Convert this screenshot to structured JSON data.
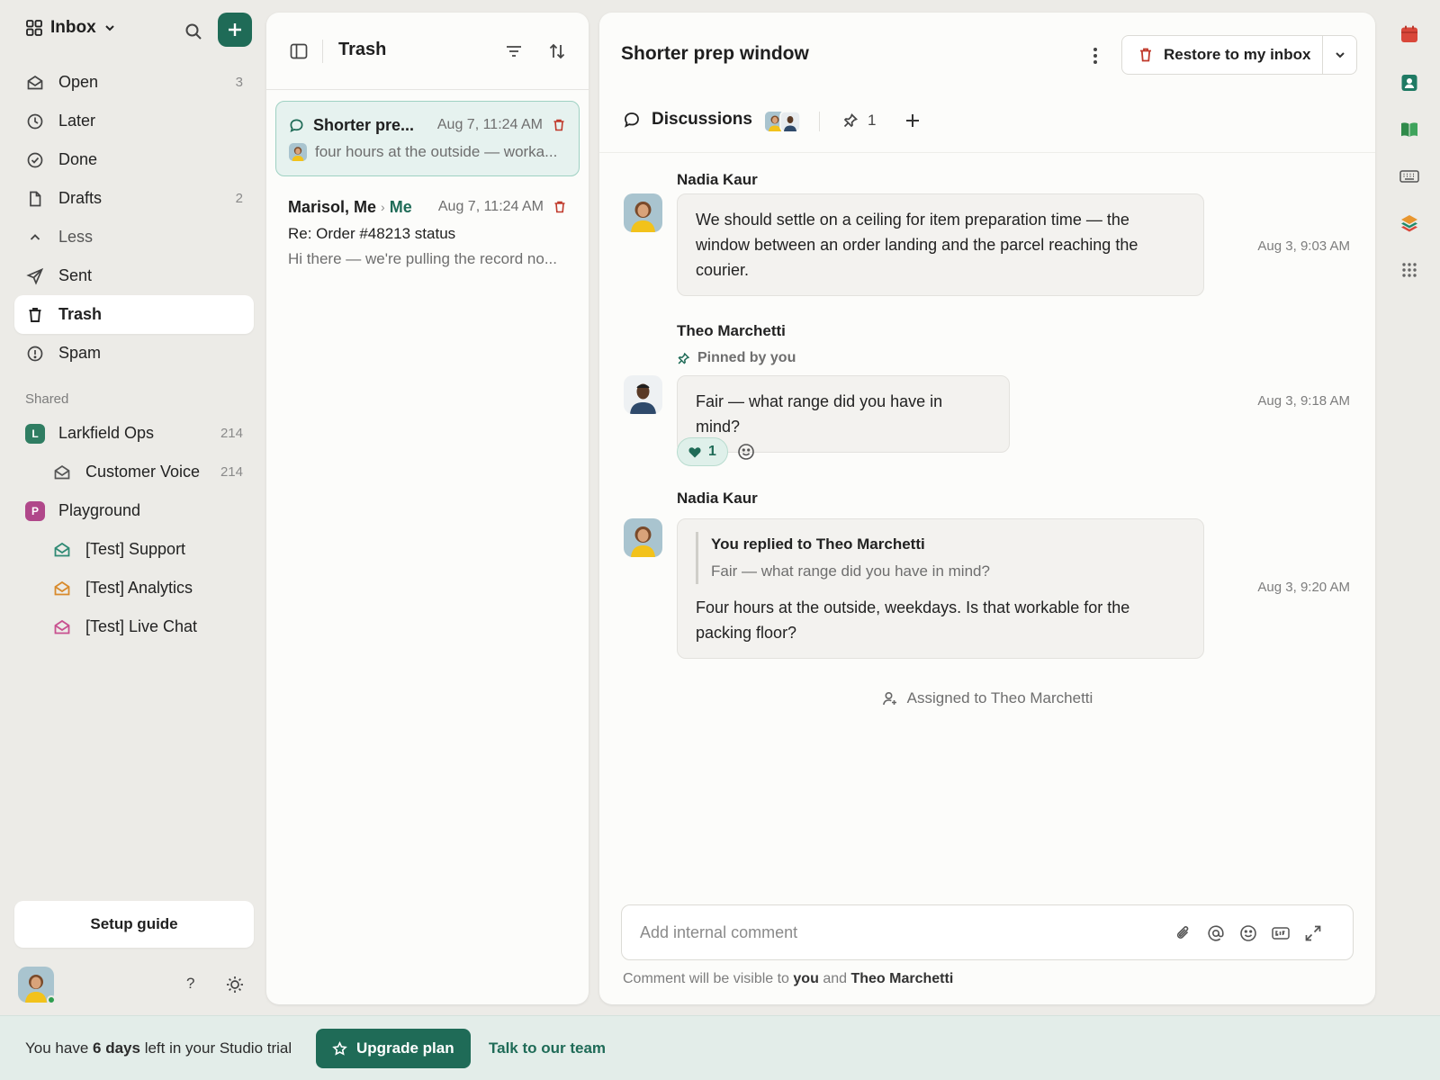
{
  "sidebar": {
    "inbox_title": "Inbox",
    "nav": [
      {
        "label": "Open",
        "count": "3"
      },
      {
        "label": "Later",
        "count": ""
      },
      {
        "label": "Done",
        "count": ""
      },
      {
        "label": "Drafts",
        "count": "2"
      },
      {
        "label": "Less",
        "count": ""
      },
      {
        "label": "Sent",
        "count": ""
      },
      {
        "label": "Trash",
        "count": ""
      },
      {
        "label": "Spam",
        "count": ""
      }
    ],
    "shared_label": "Shared",
    "shared": [
      {
        "badge": "L",
        "label": "Larkfield Ops",
        "count": "214",
        "color": "#2f7d62"
      },
      {
        "label": "Customer Voice",
        "count": "214"
      },
      {
        "badge": "P",
        "label": "Playground",
        "count": "",
        "color": "#b0478a"
      },
      {
        "label": "[Test] Support",
        "count": "",
        "color": "#2f8a74"
      },
      {
        "label": "[Test] Analytics",
        "count": "",
        "color": "#d88a2c"
      },
      {
        "label": "[Test] Live Chat",
        "count": "",
        "color": "#c8508f"
      }
    ],
    "setup_guide": "Setup guide",
    "help": "?"
  },
  "list": {
    "title": "Trash",
    "conversations": [
      {
        "subject": "Shorter pre...",
        "time": "Aug 7, 11:24 AM",
        "preview": "four hours at the outside — worka..."
      },
      {
        "from": "Marisol, Me",
        "to": "Me",
        "time": "Aug 7, 11:24 AM",
        "subject": "Re: Order #48213 status",
        "preview": "Hi there — we're pulling the record no..."
      }
    ]
  },
  "detail": {
    "title": "Shorter prep window",
    "restore_label": "Restore to my inbox",
    "tab_label": "Discussions",
    "pin_count": "1",
    "messages": [
      {
        "author": "Nadia Kaur",
        "text": "We should settle on a ceiling for item preparation time — the window between an order landing and the parcel reaching the courier.",
        "time": "Aug 3, 9:03 AM"
      },
      {
        "author": "Theo Marchetti",
        "pinned": "Pinned by you",
        "text": "Fair — what range did you have in mind?",
        "time": "Aug 3, 9:18 AM",
        "reaction_count": "1"
      },
      {
        "author": "Nadia Kaur",
        "quote_head": "You replied to Theo Marchetti",
        "quote_text": "Fair — what range did you have in mind?",
        "text": "Four hours at the outside, weekdays. Is that workable for the packing floor?",
        "time": "Aug 3, 9:20 AM"
      }
    ],
    "assigned": "Assigned to Theo Marchetti",
    "composer_placeholder": "Add internal comment",
    "visibility_prefix": "Comment will be visible to",
    "visibility_you": "you",
    "visibility_and": "and",
    "visibility_name": "Theo Marchetti"
  },
  "trial": {
    "prefix": "You have",
    "days": "6 days",
    "suffix": "left in your Studio trial",
    "upgrade": "Upgrade plan",
    "talk": "Talk to our team"
  },
  "colors": {
    "accent": "#1f6b57",
    "danger": "#c0392b",
    "selected_bg": "#e6f2ef"
  }
}
